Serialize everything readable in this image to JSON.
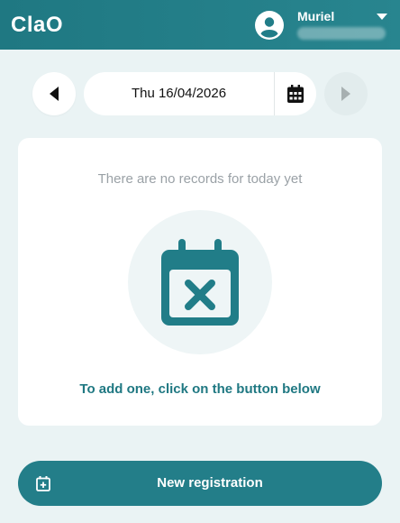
{
  "header": {
    "app_title": "ClaO",
    "user_name": "Muriel",
    "avatar_icon": "user-circle-icon",
    "menu_icon": "caret-down-icon"
  },
  "date_nav": {
    "prev_icon": "chevron-left-icon",
    "next_icon": "chevron-right-icon",
    "date": "Thu 16/04/2026",
    "calendar_icon": "calendar-icon"
  },
  "empty_state": {
    "message": "There are no records for today yet",
    "icon": "calendar-x-icon",
    "hint": "To add one, click on the button below"
  },
  "actions": {
    "new_label": "New registration",
    "new_icon": "calendar-plus-icon"
  },
  "colors": {
    "primary": "#1f7882",
    "background": "#eaf3f4",
    "muted_text": "#9aa1a6"
  }
}
